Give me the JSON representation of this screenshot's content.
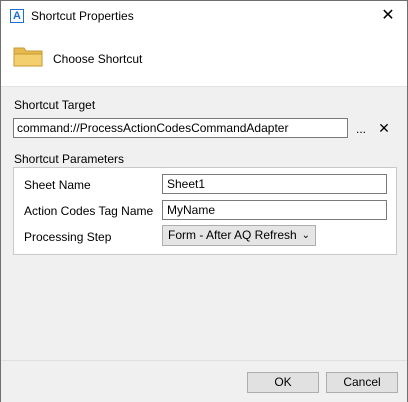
{
  "window": {
    "title": "Shortcut Properties",
    "app_icon_letter": "A"
  },
  "header": {
    "label": "Choose Shortcut"
  },
  "target": {
    "section_label": "Shortcut Target",
    "value": "command://ProcessActionCodesCommandAdapter",
    "browse_label": "...",
    "clear_label": "✕"
  },
  "params": {
    "section_label": "Shortcut Parameters",
    "rows": [
      {
        "label": "Sheet Name",
        "value": "Sheet1"
      },
      {
        "label": "Action Codes Tag Name",
        "value": "MyName"
      },
      {
        "label": "Processing Step",
        "value": "Form - After AQ Refresh"
      }
    ]
  },
  "footer": {
    "ok_label": "OK",
    "cancel_label": "Cancel"
  },
  "icons": [
    "app-icon",
    "close-icon",
    "folder-icon",
    "chevron-down-icon"
  ],
  "colors": {
    "accent": "#1e6fd0",
    "folder": "#e8b94e"
  }
}
